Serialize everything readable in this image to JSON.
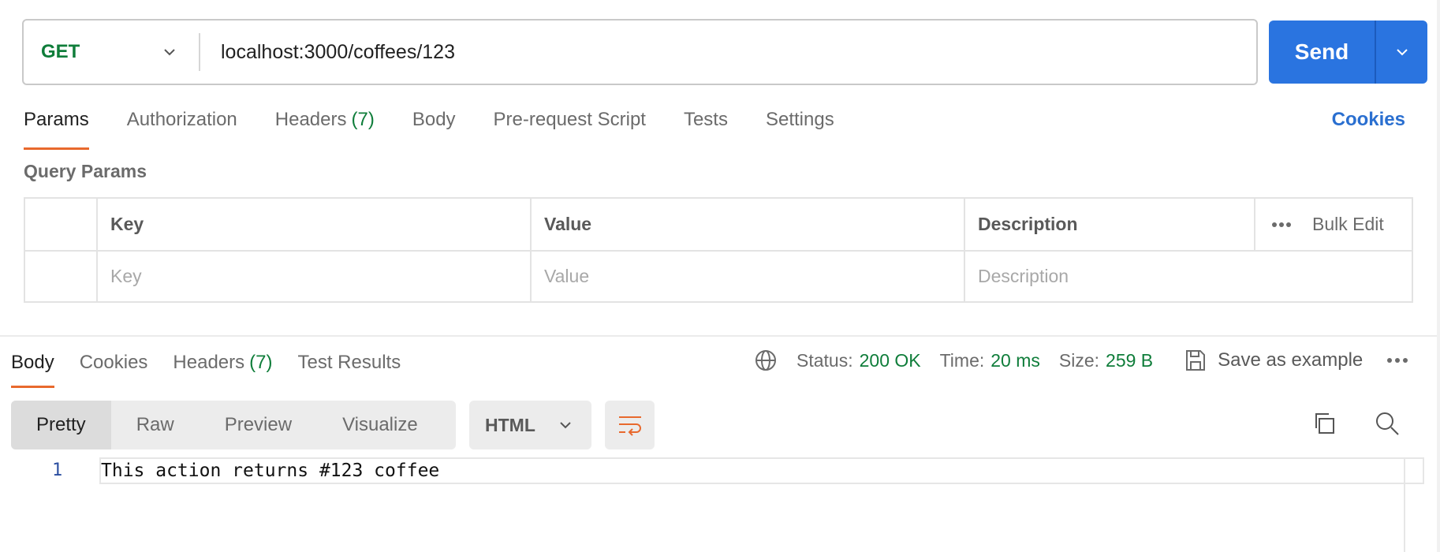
{
  "request": {
    "method": "GET",
    "url": "localhost:3000/coffees/123",
    "send_label": "Send"
  },
  "request_tabs": [
    {
      "label": "Params",
      "count": ""
    },
    {
      "label": "Authorization",
      "count": ""
    },
    {
      "label": "Headers",
      "count": "(7)"
    },
    {
      "label": "Body",
      "count": ""
    },
    {
      "label": "Pre-request Script",
      "count": ""
    },
    {
      "label": "Tests",
      "count": ""
    },
    {
      "label": "Settings",
      "count": ""
    }
  ],
  "cookies_link": "Cookies",
  "query_params": {
    "title": "Query Params",
    "headers": {
      "key": "Key",
      "value": "Value",
      "description": "Description",
      "bulk_edit": "Bulk Edit"
    },
    "placeholders": {
      "key": "Key",
      "value": "Value",
      "description": "Description"
    }
  },
  "response_tabs": [
    {
      "label": "Body",
      "count": ""
    },
    {
      "label": "Cookies",
      "count": ""
    },
    {
      "label": "Headers",
      "count": "(7)"
    },
    {
      "label": "Test Results",
      "count": ""
    }
  ],
  "response_meta": {
    "status_label": "Status:",
    "status_value": "200 OK",
    "time_label": "Time:",
    "time_value": "20 ms",
    "size_label": "Size:",
    "size_value": "259 B",
    "save_example": "Save as example"
  },
  "view_modes": [
    "Pretty",
    "Raw",
    "Preview",
    "Visualize"
  ],
  "language": "HTML",
  "code": {
    "line_number": "1",
    "line_text": "This action returns #123 coffee"
  },
  "colors": {
    "accent_orange": "#e8692d",
    "send_blue": "#2a74e0",
    "success_green": "#0f7d3a",
    "link_blue": "#2a6fd0"
  },
  "icons": [
    "chevron-down-icon",
    "globe-icon",
    "save-icon",
    "more-icon",
    "wrap-lines-icon",
    "copy-icon",
    "search-icon"
  ]
}
